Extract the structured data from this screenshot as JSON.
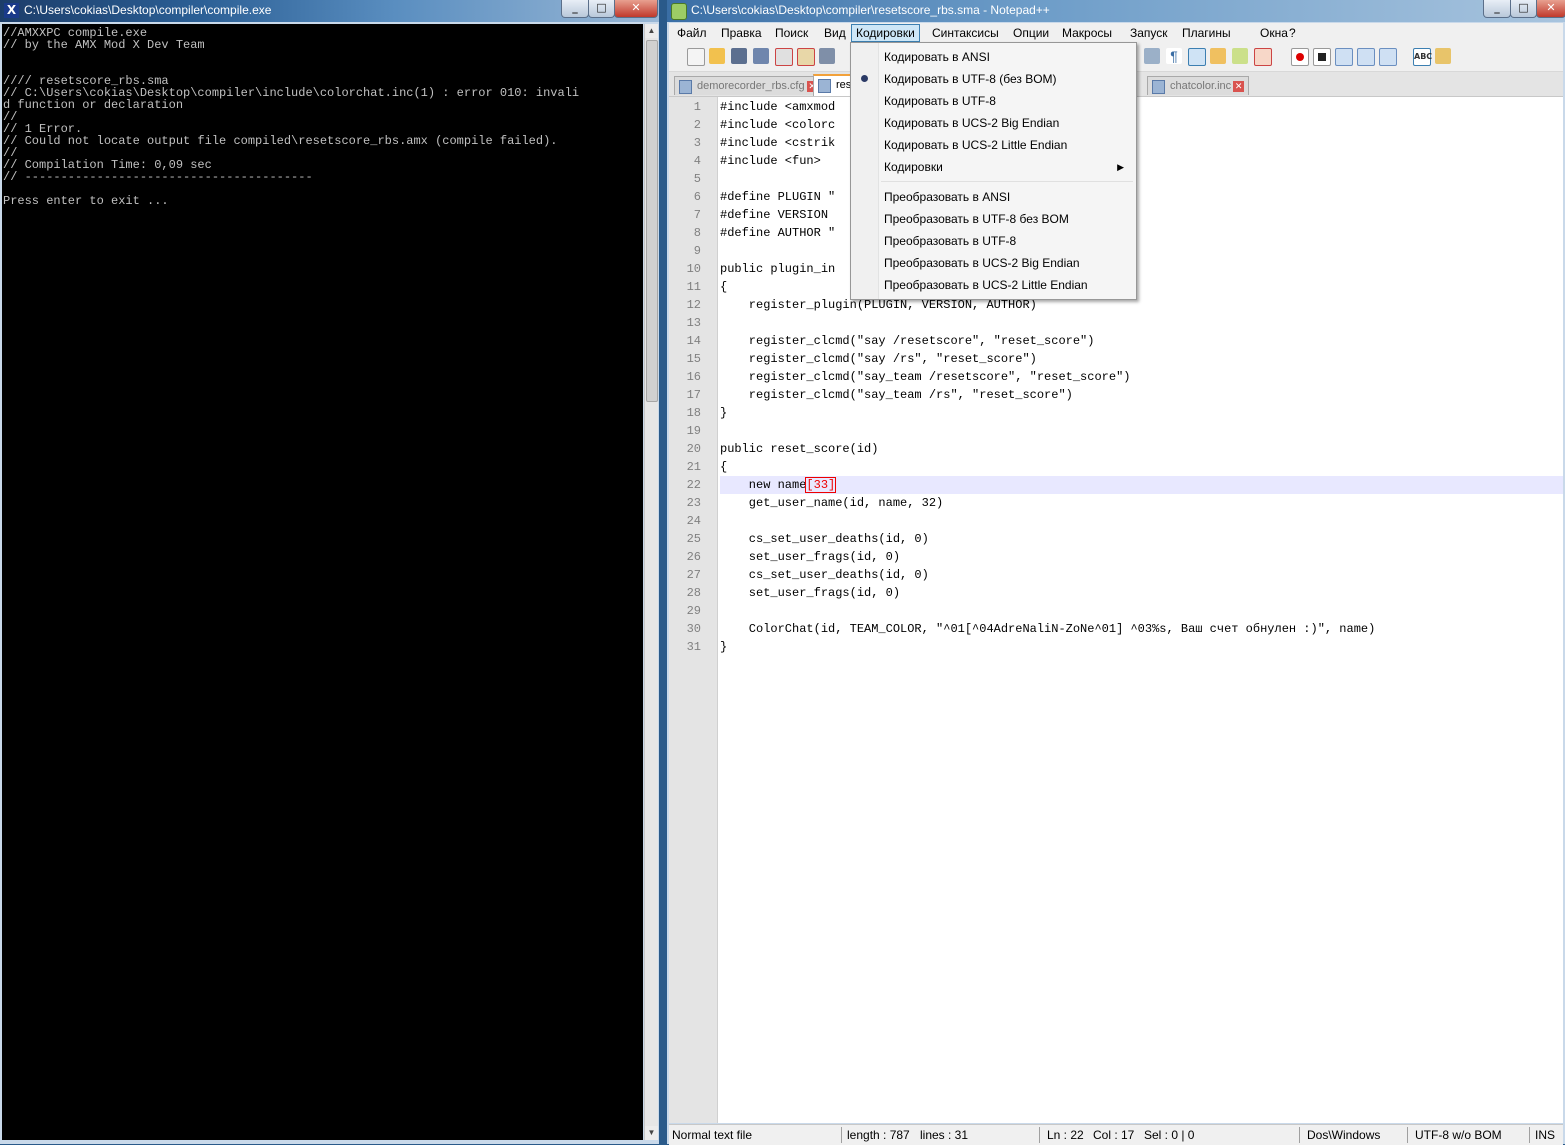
{
  "console": {
    "title": "C:\\Users\\cokias\\Desktop\\compiler\\compile.exe",
    "output": "//AMXXPC compile.exe\n// by the AMX Mod X Dev Team\n\n\n//// resetscore_rbs.sma\n// C:\\Users\\cokias\\Desktop\\compiler\\include\\colorchat.inc(1) : error 010: invali\nd function or declaration\n//\n// 1 Error.\n// Could not locate output file compiled\\resetscore_rbs.amx (compile failed).\n//\n// Compilation Time: 0,09 sec\n// ----------------------------------------\n\nPress enter to exit ..."
  },
  "npp": {
    "title": "C:\\Users\\cokias\\Desktop\\compiler\\resetscore_rbs.sma - Notepad++",
    "menu": [
      "Файл",
      "Правка",
      "Поиск",
      "Вид",
      "Кодировки",
      "Синтаксисы",
      "Опции",
      "Макросы",
      "Запуск",
      "Плагины",
      "Окна",
      "?"
    ],
    "tabs": [
      {
        "label": "demorecorder_rbs.cfg",
        "active": false
      },
      {
        "label": "rese",
        "active": true
      },
      {
        "label": "chatcolor.inc",
        "active": false
      }
    ],
    "code": [
      "#include <amxmod",
      "#include <colorc",
      "#include <cstrik",
      "#include <fun>",
      "",
      "#define PLUGIN \"",
      "#define VERSION ",
      "#define AUTHOR \"",
      "",
      "public plugin_in",
      "{",
      "    register_plugin(PLUGIN, VERSION, AUTHOR)",
      "",
      "    register_clcmd(\"say /resetscore\", \"reset_score\")",
      "    register_clcmd(\"say /rs\", \"reset_score\")",
      "    register_clcmd(\"say_team /resetscore\", \"reset_score\")",
      "    register_clcmd(\"say_team /rs\", \"reset_score\")",
      "}",
      "",
      "public reset_score(id)",
      "{",
      "    new name[33]",
      "    get_user_name(id, name, 32)",
      "",
      "    cs_set_user_deaths(id, 0)",
      "    set_user_frags(id, 0)",
      "    cs_set_user_deaths(id, 0)",
      "    set_user_frags(id, 0)",
      "",
      "    ColorChat(id, TEAM_COLOR, \"^01[^04AdreNaliN-ZoNe^01] ^03%s, Ваш счет обнулен :)\", name)",
      "}"
    ],
    "current_line": 22,
    "status": {
      "type": "Normal text file",
      "length": "length : 787",
      "lines": "lines : 31",
      "ln": "Ln : 22",
      "col": "Col : 17",
      "sel": "Sel : 0 | 0",
      "eol": "Dos\\Windows",
      "encoding": "UTF-8 w/o BOM",
      "mode": "INS"
    }
  },
  "dropdown": {
    "items": [
      {
        "label": "Кодировать в ANSI",
        "checked": false,
        "submenu": false
      },
      {
        "label": "Кодировать в UTF-8 (без BOM)",
        "checked": true,
        "submenu": false
      },
      {
        "label": "Кодировать в UTF-8",
        "checked": false,
        "submenu": false
      },
      {
        "label": "Кодировать в UCS-2 Big Endian",
        "checked": false,
        "submenu": false
      },
      {
        "label": "Кодировать в UCS-2 Little Endian",
        "checked": false,
        "submenu": false
      },
      {
        "label": "Кодировки",
        "checked": false,
        "submenu": true
      },
      {
        "label": "Преобразовать в ANSI",
        "checked": false,
        "submenu": false
      },
      {
        "label": "Преобразовать в UTF-8 без BOM",
        "checked": false,
        "submenu": false
      },
      {
        "label": "Преобразовать в UTF-8",
        "checked": false,
        "submenu": false
      },
      {
        "label": "Преобразовать в UCS-2 Big Endian",
        "checked": false,
        "submenu": false
      },
      {
        "label": "Преобразовать в UCS-2 Little Endian",
        "checked": false,
        "submenu": false
      }
    ]
  }
}
